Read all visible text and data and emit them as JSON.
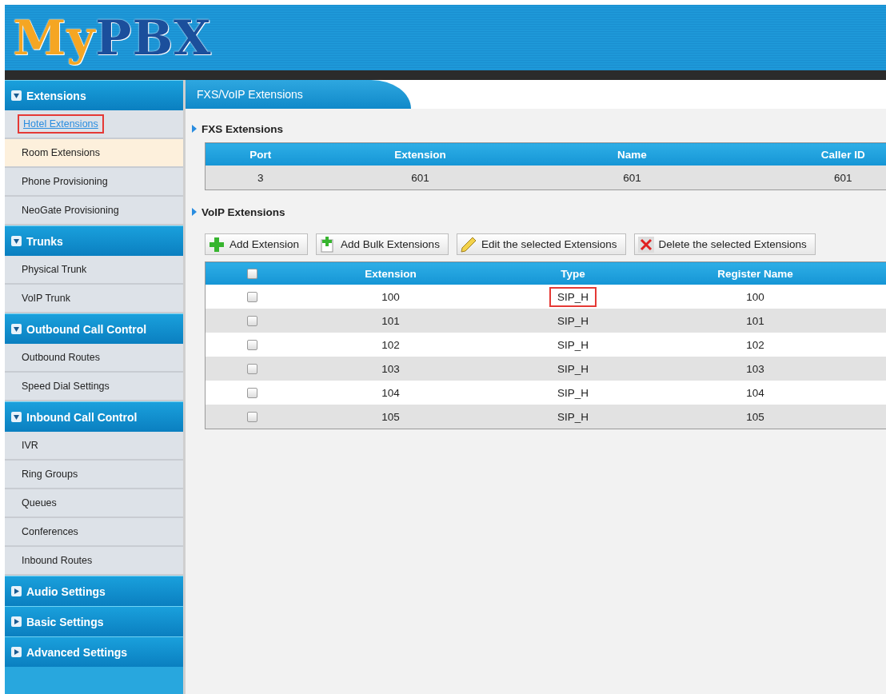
{
  "logo": {
    "part_1": "My",
    "part_2": "PBX"
  },
  "sidebar": {
    "sections": [
      {
        "label": "Extensions",
        "expanded": true,
        "items": [
          {
            "label": "Hotel Extensions",
            "kind": "link",
            "selected": false,
            "annotated": true
          },
          {
            "label": "Room Extensions",
            "kind": "item",
            "selected": true
          },
          {
            "label": "Phone Provisioning",
            "kind": "item",
            "selected": false
          },
          {
            "label": "NeoGate Provisioning",
            "kind": "item",
            "selected": false
          }
        ]
      },
      {
        "label": "Trunks",
        "expanded": true,
        "items": [
          {
            "label": "Physical Trunk",
            "kind": "item",
            "selected": false
          },
          {
            "label": "VoIP Trunk",
            "kind": "item",
            "selected": false
          }
        ]
      },
      {
        "label": "Outbound Call Control",
        "expanded": true,
        "items": [
          {
            "label": "Outbound Routes",
            "kind": "item",
            "selected": false
          },
          {
            "label": "Speed Dial Settings",
            "kind": "item",
            "selected": false
          }
        ]
      },
      {
        "label": "Inbound Call Control",
        "expanded": true,
        "items": [
          {
            "label": "IVR",
            "kind": "item",
            "selected": false
          },
          {
            "label": "Ring Groups",
            "kind": "item",
            "selected": false
          },
          {
            "label": "Queues",
            "kind": "item",
            "selected": false
          },
          {
            "label": "Conferences",
            "kind": "item",
            "selected": false
          },
          {
            "label": "Inbound Routes",
            "kind": "item",
            "selected": false
          }
        ]
      },
      {
        "label": "Audio Settings",
        "expanded": false
      },
      {
        "label": "Basic Settings",
        "expanded": false
      },
      {
        "label": "Advanced Settings",
        "expanded": false
      }
    ]
  },
  "page_title": "FXS/VoIP Extensions",
  "fxs": {
    "title": "FXS Extensions",
    "columns": [
      "Port",
      "Extension",
      "Name",
      "Caller ID"
    ],
    "rows": [
      [
        "3",
        "601",
        "601",
        "601"
      ]
    ]
  },
  "voip": {
    "title": "VoIP Extensions",
    "buttons": [
      {
        "label": "Add Extension",
        "kind": "add"
      },
      {
        "label": "Add Bulk Extensions",
        "kind": "bulk"
      },
      {
        "label": "Edit the selected Extensions",
        "kind": "edit"
      },
      {
        "label": "Delete the selected Extensions",
        "kind": "delete"
      }
    ],
    "header_checked": false,
    "columns": [
      "Extension",
      "Type",
      "Register Name"
    ],
    "rows": [
      {
        "extension": "100",
        "type": "SIP_H",
        "register_name": "100",
        "checked": false,
        "type_annotated": true
      },
      {
        "extension": "101",
        "type": "SIP_H",
        "register_name": "101",
        "checked": false,
        "type_annotated": false
      },
      {
        "extension": "102",
        "type": "SIP_H",
        "register_name": "102",
        "checked": false,
        "type_annotated": false
      },
      {
        "extension": "103",
        "type": "SIP_H",
        "register_name": "103",
        "checked": false,
        "type_annotated": false
      },
      {
        "extension": "104",
        "type": "SIP_H",
        "register_name": "104",
        "checked": false,
        "type_annotated": false
      },
      {
        "extension": "105",
        "type": "SIP_H",
        "register_name": "105",
        "checked": false,
        "type_annotated": false
      }
    ]
  }
}
